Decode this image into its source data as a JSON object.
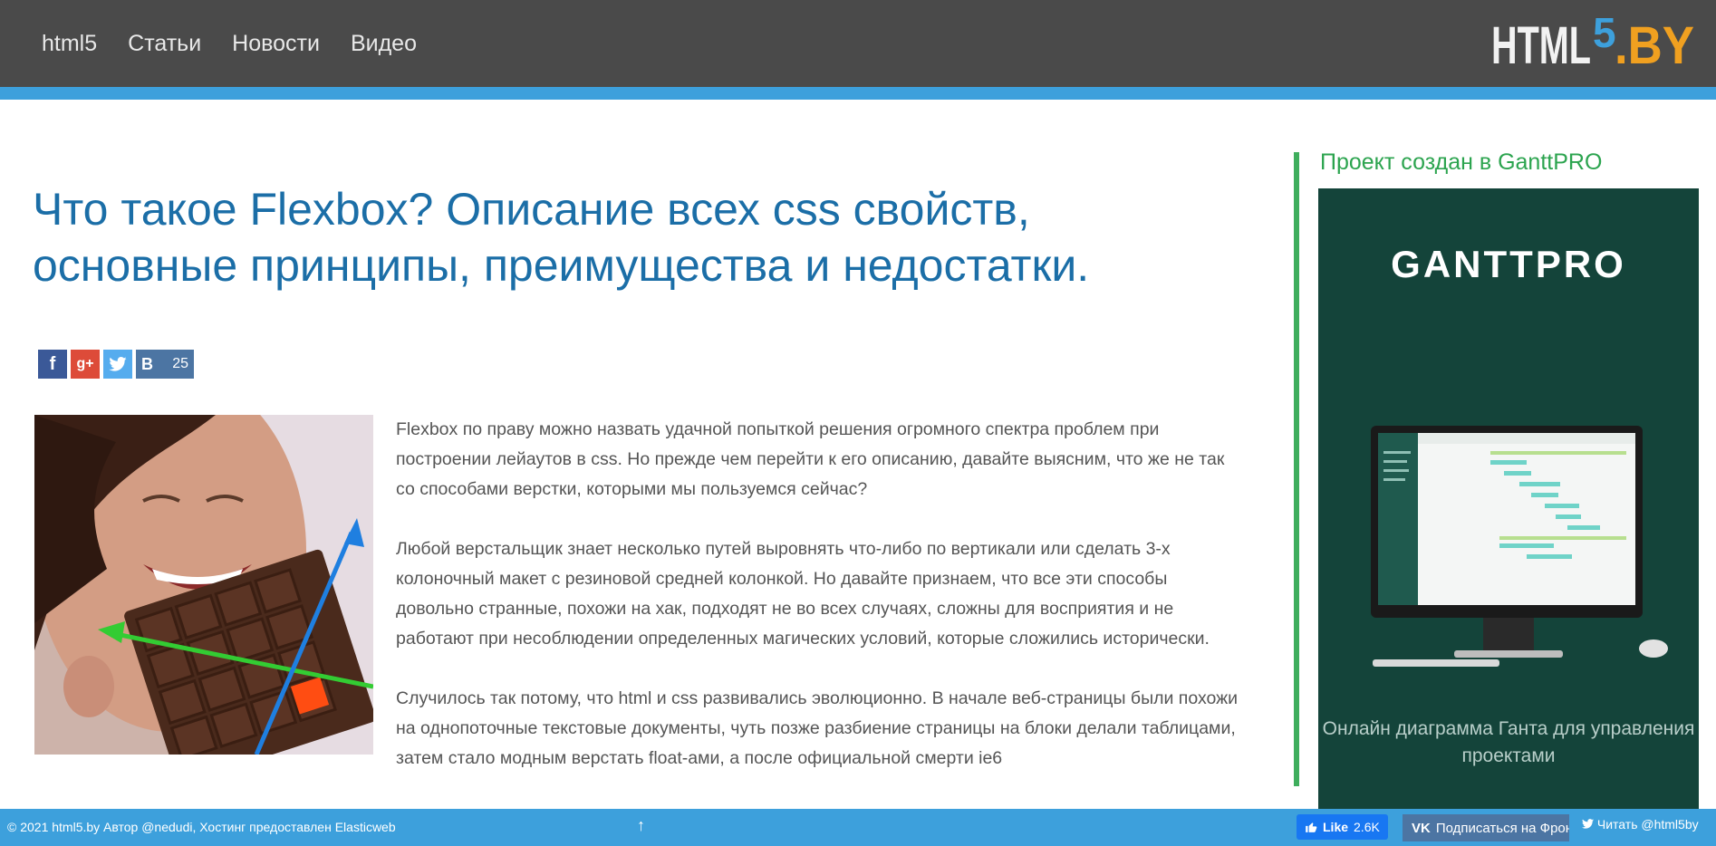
{
  "header": {
    "nav": [
      "html5",
      "Статьи",
      "Новости",
      "Видео"
    ],
    "logo_text": "HTML5.BY",
    "logo_digit": "5",
    "colors": {
      "bg": "#4a4a4a",
      "stripe": "#3da0dc",
      "logo_white": "#f2f2f2",
      "logo_blue": "#3da0dc",
      "logo_orange": "#f0a020"
    }
  },
  "article": {
    "title": "Что такое Flexbox? Описание всех css свойств, основные принципы, преимущества и недостатки.",
    "share": {
      "vk_count": "25",
      "icons": [
        "facebook-icon",
        "google-plus-icon",
        "twitter-icon",
        "vk-icon"
      ]
    },
    "paragraphs": [
      "Flexbox по праву можно назвать удачной попыткой решения огромного спектра проблем при построении лейаутов в css. Но прежде чем перейти к его описанию, давайте выясним, что же не так со способами верстки, которыми мы пользуемся сейчас?",
      "Любой верстальщик знает несколько путей выровнять что-либо по вертикали или сделать 3-х колоночный макет с резиновой средней колонкой. Но давайте признаем, что все эти способы довольно странные, похожи на хак, подходят не во всех случаях, сложны для восприятия и не работают при несоблюдении определенных магических условий, которые сложились исторически.",
      "Случилось так потому, что html и css развивались эволюционно. В начале веб-страницы были похожи на однопоточные текстовые документы, чуть позже разбиение страницы на блоки делали таблицами, затем стало модным верстать float-ами, а после официальной смерти ie6"
    ]
  },
  "sidebar": {
    "title": "Проект создан в GanttPRO",
    "ad_brand": "GANTTPRO",
    "ad_caption": "Онлайн диаграмма Ганта для управления проектами"
  },
  "footer": {
    "copyright": "© 2021 html5.by Автор @nedudi, Хостинг предоставлен Elasticweb",
    "up_arrow": "↑",
    "like_label": "Like",
    "like_count": "2.6K",
    "vk_subscribe": "Подписаться на Фронт",
    "twitter_read": "Читать @html5by"
  }
}
